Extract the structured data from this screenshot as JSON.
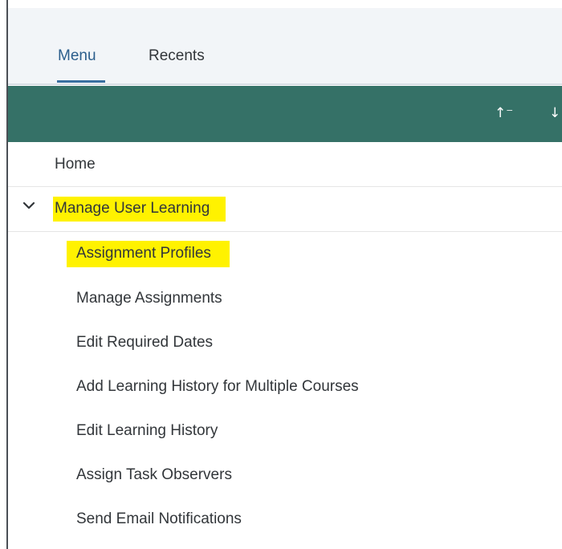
{
  "tabs": {
    "menu_label": "Menu",
    "recents_label": "Recents"
  },
  "toolbar": {
    "sort_ascending_label": "↑⁻",
    "sort_descending_label": "↓",
    "background_color": "#357167"
  },
  "menu": {
    "home_label": "Home",
    "group_label": "Manage User Learning",
    "group_expanded": true,
    "children": [
      "Assignment Profiles",
      "Manage Assignments",
      "Edit Required Dates",
      "Add Learning History for Multiple Courses",
      "Edit Learning History",
      "Assign Task Observers",
      "Send Email Notifications"
    ]
  },
  "highlight_color": "#fff200"
}
